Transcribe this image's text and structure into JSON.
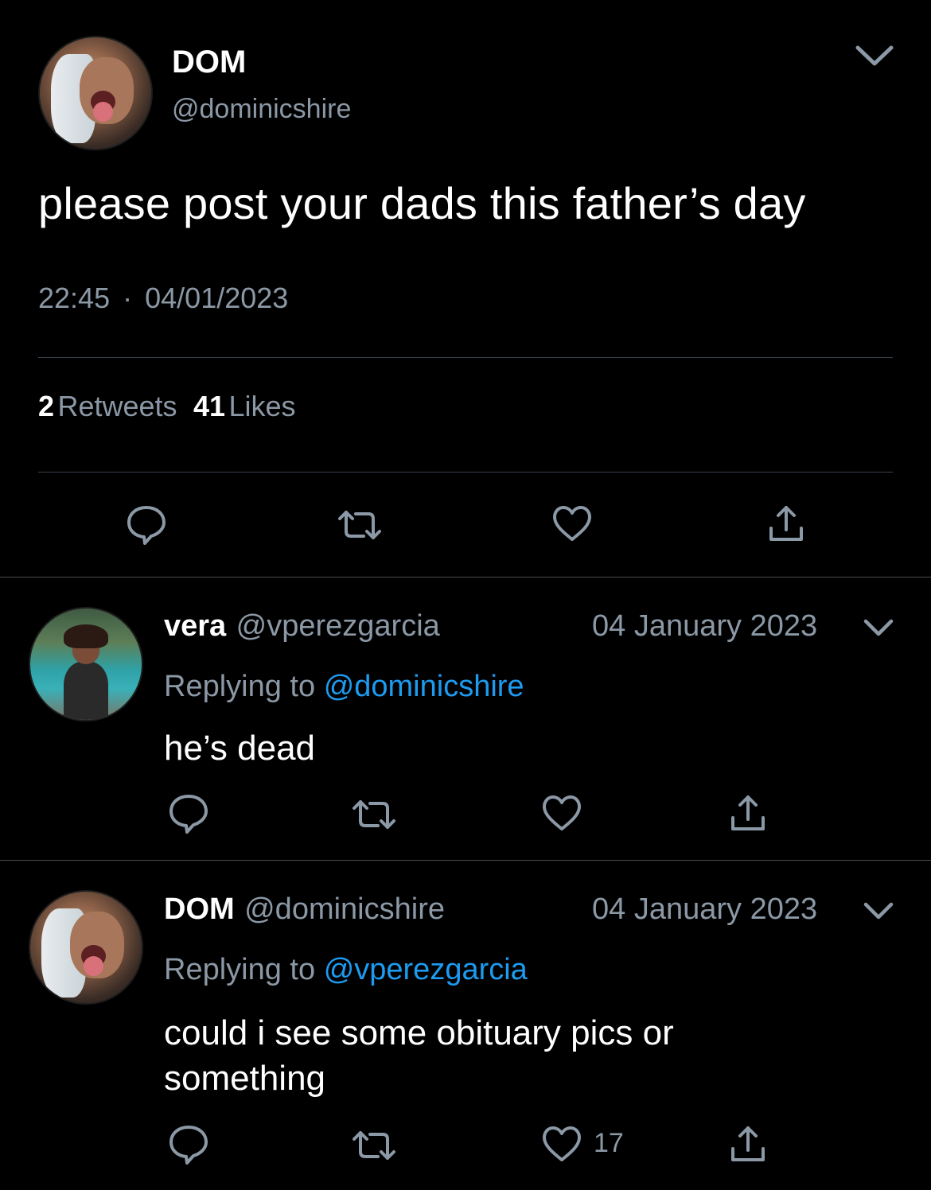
{
  "main_tweet": {
    "display_name": "DOM",
    "handle": "@dominicshire",
    "text": "please post your dads this father’s day",
    "time": "22:45",
    "separator": "·",
    "date": "04/01/2023",
    "retweets_count": "2",
    "retweets_label": "Retweets",
    "likes_count": "41",
    "likes_label": "Likes"
  },
  "replies": [
    {
      "display_name": "vera",
      "handle": "@vperezgarcia",
      "date": "04 January 2023",
      "replying_prefix": "Replying to",
      "replying_handle": "@dominicshire",
      "text": "he’s dead",
      "like_count": ""
    },
    {
      "display_name": "DOM",
      "handle": "@dominicshire",
      "date": "04 January 2023",
      "replying_prefix": "Replying to",
      "replying_handle": "@vperezgarcia",
      "text_line1": "could i see some obituary pics or",
      "text_line2": "something",
      "like_count": "17"
    }
  ],
  "icons": {
    "reply": "speech-bubble-icon",
    "retweet": "retweet-arrows-icon",
    "like": "heart-icon",
    "share": "share-upload-icon",
    "more": "chevron-down-icon"
  },
  "colors": {
    "background": "#000000",
    "text": "#ffffff",
    "muted": "#8b98a5",
    "link": "#1d9bf0",
    "divider": "#38444d"
  }
}
